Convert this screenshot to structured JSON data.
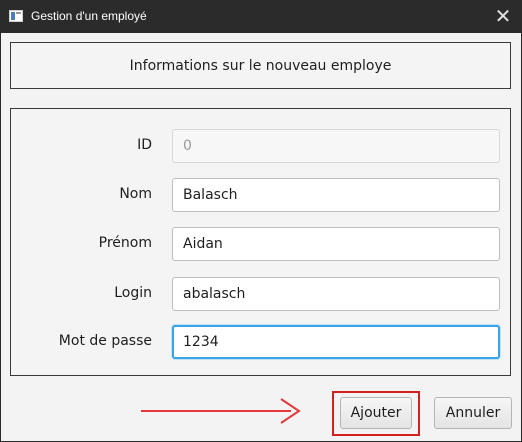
{
  "window": {
    "title": "Gestion d'un employé",
    "close_glyph": "✕"
  },
  "header": {
    "text": "Informations sur le nouveau employe"
  },
  "form": {
    "fields": [
      {
        "label": "ID",
        "value": "0",
        "state": "disabled"
      },
      {
        "label": "Nom",
        "value": "Balasch",
        "state": "normal"
      },
      {
        "label": "Prénom",
        "value": "Aidan",
        "state": "normal"
      },
      {
        "label": "Login",
        "value": "abalasch",
        "state": "normal"
      },
      {
        "label": "Mot de passe",
        "value": "1234",
        "state": "focused"
      }
    ]
  },
  "buttons": {
    "add": "Ajouter",
    "cancel": "Annuler"
  },
  "colors": {
    "highlight": "#d21f1f",
    "focus_ring": "#3ba3e6"
  }
}
